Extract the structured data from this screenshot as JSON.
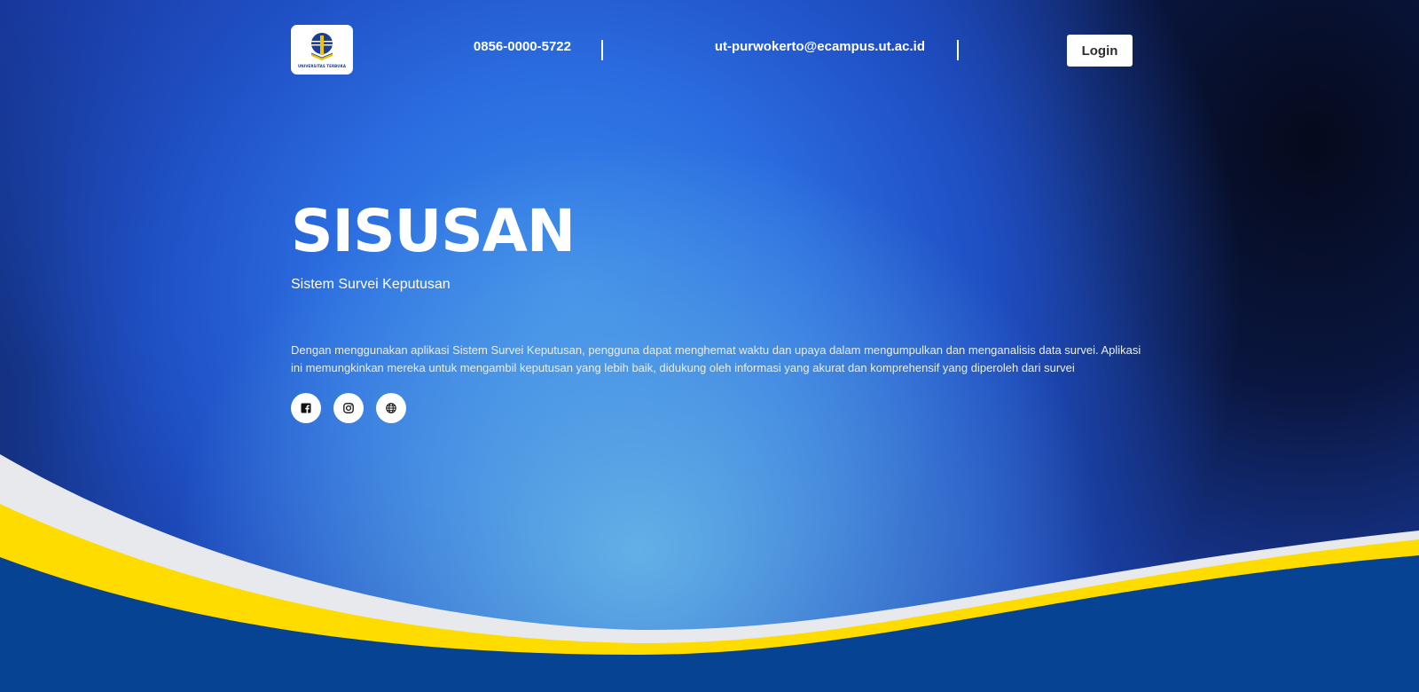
{
  "header": {
    "logo_caption": "UNIVERSITAS TERBUKA",
    "phone": "0856-0000-5722",
    "email": "ut-purwokerto@ecampus.ut.ac.id",
    "login_label": "Login"
  },
  "hero": {
    "title": "SISUSAN",
    "subtitle": "Sistem Survei Keputusan",
    "description": "Dengan menggunakan aplikasi Sistem Survei Keputusan, pengguna dapat menghemat waktu dan upaya dalam mengumpulkan dan menganalisis data survei. Aplikasi ini memungkinkan mereka untuk mengambil keputusan yang lebih baik, didukung oleh informasi yang akurat dan komprehensif yang diperoleh dari survei"
  },
  "socials": [
    {
      "icon": "facebook-icon"
    },
    {
      "icon": "instagram-icon"
    },
    {
      "icon": "globe-icon"
    }
  ],
  "colors": {
    "brand_blue": "#1a3f95",
    "wave_yellow": "#ffdc00",
    "wave_gray": "#e8e9ec",
    "footer_blue": "#064393"
  }
}
